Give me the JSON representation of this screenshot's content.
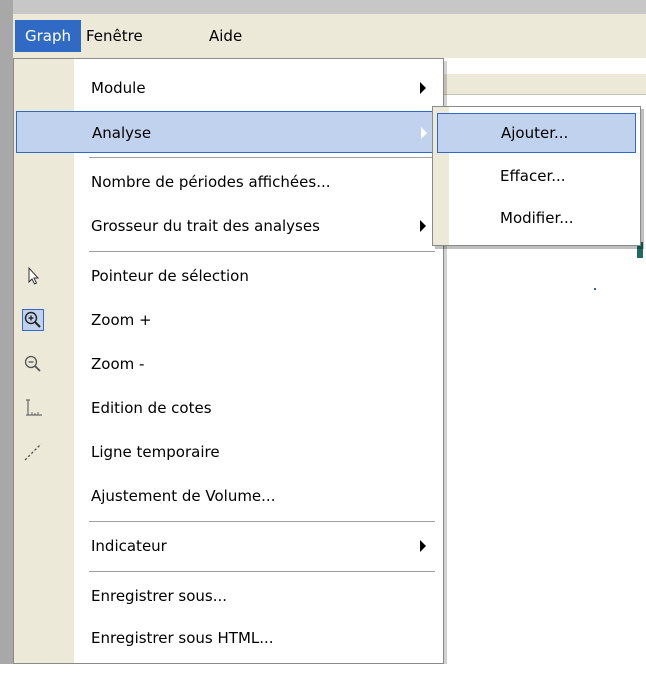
{
  "menubar": {
    "items": [
      {
        "label": "Graph"
      },
      {
        "label": "Fenêtre"
      },
      {
        "label": "Aide"
      }
    ]
  },
  "graph_menu": {
    "items": [
      {
        "label": "Module",
        "submenu": true
      },
      {
        "label": "Analyse",
        "submenu": true,
        "highlighted": true
      },
      {
        "label": "Nombre de périodes affichées..."
      },
      {
        "label": "Grosseur du trait des analyses",
        "submenu": true
      },
      {
        "label": "Pointeur de sélection",
        "icon": "arrow-pointer-icon"
      },
      {
        "label": "Zoom +",
        "icon": "zoom-in-icon",
        "checked": true
      },
      {
        "label": "Zoom -",
        "icon": "zoom-out-icon"
      },
      {
        "label": "Edition de cotes",
        "icon": "dimension-edit-icon"
      },
      {
        "label": "Ligne temporaire",
        "icon": "dashed-line-icon"
      },
      {
        "label": "Ajustement de Volume..."
      },
      {
        "label": "Indicateur",
        "submenu": true
      },
      {
        "label": "Enregistrer sous..."
      },
      {
        "label": "Enregistrer sous HTML..."
      }
    ]
  },
  "analyse_submenu": {
    "items": [
      {
        "label": "Ajouter...",
        "highlighted": true
      },
      {
        "label": "Effacer..."
      },
      {
        "label": "Modifier..."
      }
    ]
  },
  "colors": {
    "menu_highlight": "#c1d2ee",
    "menu_highlight_border": "#316ac5",
    "menubar_active": "#316ac5",
    "gutter": "#ece9d8"
  }
}
